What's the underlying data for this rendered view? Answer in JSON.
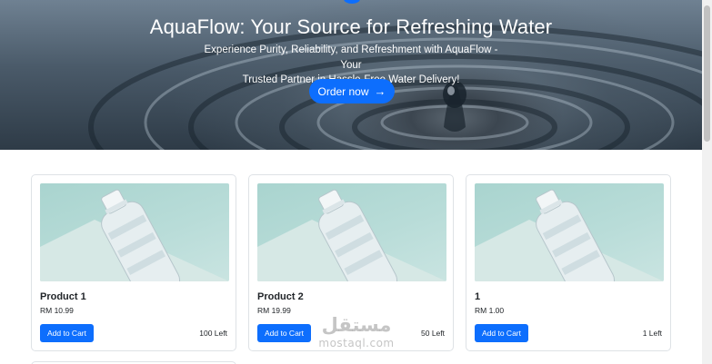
{
  "hero": {
    "title": "AquaFlow: Your Source for Refreshing Water",
    "subtitle_line1": "Experience Purity, Reliability, and Refreshment with AquaFlow - Your",
    "subtitle_line2": "Trusted Partner in Hassle-Free Water Delivery!",
    "order_button_label": "Order now",
    "order_button_icon": "arrow-right-icon"
  },
  "products": [
    {
      "name": "Product 1",
      "price": "RM 10.99",
      "button_label": "Add to Cart",
      "stock": "100 Left",
      "image_icon": "water-bottle-image"
    },
    {
      "name": "Product 2",
      "price": "RM 19.99",
      "button_label": "Add to Cart",
      "stock": "50 Left",
      "image_icon": "water-bottle-image"
    },
    {
      "name": "1",
      "price": "RM 1.00",
      "button_label": "Add to Cart",
      "stock": "1 Left",
      "image_icon": "water-bottle-image"
    }
  ],
  "watermark": {
    "arabic": "مستقل",
    "latin": "mostaql.com"
  },
  "colors": {
    "primary": "#0d6efd",
    "card_border": "#dee2e6",
    "image_bg": "#b8dcd8"
  }
}
